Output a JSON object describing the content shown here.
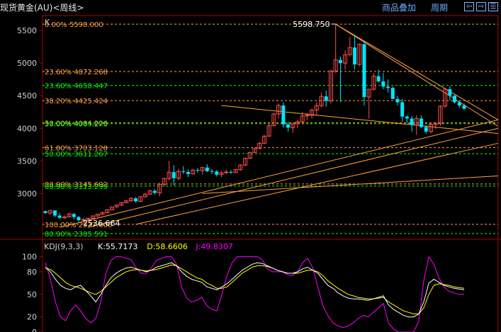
{
  "header": {
    "title": "现货黄金(AU)<周线>",
    "overlay_btn": "商品叠加",
    "period_btn": "周期",
    "prev_icon": "⇦",
    "next_icon": "⇨",
    "menu_icon": "☰"
  },
  "colors": {
    "up": "#ff4d4d",
    "down": "#00e5ff",
    "fib": "#ffa040",
    "fib_green": "#00ff00",
    "trend": "#ffa040",
    "k": "#ffffff",
    "d": "#ffff00",
    "j": "#ff00ff",
    "axis_text": "#d0d0d0",
    "frame": "#b00000",
    "grid": "#3a0000"
  },
  "chart_data": [
    {
      "type": "candlestick",
      "label": "K",
      "y_ticks": [
        3000,
        3500,
        4000,
        4500,
        5000,
        5500
      ],
      "ylim": [
        2330,
        5730
      ],
      "candles": [
        [
          2729,
          2736,
          2685,
          2700
        ],
        [
          2700,
          2745,
          2672,
          2740
        ],
        [
          2740,
          2745,
          2639,
          2661
        ],
        [
          2661,
          2703,
          2613,
          2627
        ],
        [
          2627,
          2665,
          2610,
          2640
        ],
        [
          2640,
          2706,
          2630,
          2685
        ],
        [
          2685,
          2700,
          2606,
          2639
        ],
        [
          2639,
          2655,
          2567,
          2590
        ],
        [
          2588,
          2626,
          2570,
          2603
        ],
        [
          2603,
          2630,
          2590,
          2620
        ],
        [
          2620,
          2665,
          2615,
          2655
        ],
        [
          2655,
          2690,
          2640,
          2684
        ],
        [
          2684,
          2720,
          2670,
          2705
        ],
        [
          2705,
          2760,
          2695,
          2750
        ],
        [
          2750,
          2800,
          2740,
          2795
        ],
        [
          2795,
          2836,
          2780,
          2822
        ],
        [
          2822,
          2870,
          2810,
          2860
        ],
        [
          2860,
          2899,
          2845,
          2888
        ],
        [
          2888,
          2945,
          2874,
          2925
        ],
        [
          2925,
          2948,
          2860,
          2880
        ],
        [
          2880,
          2956,
          2870,
          2950
        ],
        [
          2950,
          3010,
          2940,
          2990
        ],
        [
          2990,
          3057,
          2980,
          3040
        ],
        [
          3040,
          3070,
          2980,
          3009
        ],
        [
          3009,
          3167,
          2956,
          3140
        ],
        [
          3140,
          3245,
          3110,
          3230
        ],
        [
          3230,
          3500,
          3200,
          3327
        ],
        [
          3327,
          3435,
          3120,
          3235
        ],
        [
          3235,
          3380,
          3200,
          3340
        ],
        [
          3340,
          3420,
          3300,
          3330
        ],
        [
          3330,
          3369,
          3250,
          3300
        ],
        [
          3300,
          3380,
          3290,
          3360
        ],
        [
          3360,
          3390,
          3320,
          3350
        ],
        [
          3350,
          3410,
          3290,
          3398
        ],
        [
          3398,
          3450,
          3330,
          3342
        ],
        [
          3342,
          3375,
          3300,
          3337
        ],
        [
          3337,
          3360,
          3260,
          3290
        ],
        [
          3290,
          3340,
          3250,
          3318
        ],
        [
          3318,
          3370,
          3300,
          3330
        ],
        [
          3330,
          3360,
          3300,
          3320
        ],
        [
          3320,
          3380,
          3320,
          3365
        ],
        [
          3365,
          3450,
          3350,
          3435
        ],
        [
          3435,
          3550,
          3420,
          3540
        ],
        [
          3540,
          3640,
          3530,
          3630
        ],
        [
          3630,
          3700,
          3620,
          3690
        ],
        [
          3690,
          3790,
          3680,
          3770
        ],
        [
          3770,
          3900,
          3760,
          3880
        ],
        [
          3880,
          4060,
          3870,
          4040
        ],
        [
          4040,
          4240,
          4030,
          4220
        ],
        [
          4220,
          4380,
          4150,
          4350
        ],
        [
          4350,
          4400,
          4010,
          4060
        ],
        [
          4060,
          4100,
          3950,
          4010
        ],
        [
          4010,
          4080,
          3930,
          4070
        ],
        [
          4070,
          4130,
          4000,
          4100
        ],
        [
          4100,
          4250,
          4060,
          4190
        ],
        [
          4190,
          4240,
          4130,
          4200
        ],
        [
          4200,
          4300,
          4150,
          4280
        ],
        [
          4280,
          4400,
          4200,
          4350
        ],
        [
          4350,
          4550,
          4320,
          4490
        ],
        [
          4490,
          4580,
          4330,
          4420
        ],
        [
          4420,
          4900,
          4380,
          4880
        ],
        [
          4880,
          5600,
          4850,
          5050
        ],
        [
          5050,
          5100,
          4400,
          5000
        ],
        [
          5000,
          5200,
          4900,
          5130
        ],
        [
          5130,
          5400,
          5100,
          5240
        ],
        [
          5240,
          5420,
          4900,
          4980
        ],
        [
          4980,
          5300,
          4950,
          5290
        ],
        [
          5290,
          5340,
          4350,
          4480
        ],
        [
          4480,
          4600,
          4150,
          4600
        ],
        [
          4600,
          4850,
          4580,
          4800
        ],
        [
          4800,
          4900,
          4700,
          4720
        ],
        [
          4720,
          4850,
          4600,
          4640
        ],
        [
          4640,
          4750,
          4550,
          4620
        ],
        [
          4620,
          4640,
          4450,
          4450
        ],
        [
          4450,
          4500,
          4350,
          4400
        ],
        [
          4400,
          4450,
          4100,
          4180
        ],
        [
          4180,
          4200,
          4080,
          4150
        ],
        [
          4150,
          4190,
          3950,
          4050
        ],
        [
          4050,
          4200,
          3900,
          4150
        ],
        [
          4150,
          4200,
          4000,
          4020
        ],
        [
          4020,
          4050,
          3920,
          3950
        ],
        [
          3950,
          4080,
          3920,
          4060
        ],
        [
          4060,
          4100,
          3990,
          4070
        ],
        [
          4070,
          4350,
          4040,
          4340
        ],
        [
          4340,
          4620,
          4320,
          4600
        ],
        [
          4600,
          4650,
          4430,
          4500
        ],
        [
          4500,
          4530,
          4380,
          4400
        ],
        [
          4400,
          4420,
          4310,
          4350
        ],
        [
          4350,
          4380,
          4280,
          4300
        ]
      ],
      "fib_levels": [
        {
          "label": "0.00% 5598.000",
          "y": 5598,
          "color_key": "fib"
        },
        {
          "label": "23.60% 4872.268",
          "y": 4872,
          "color_key": "fib"
        },
        {
          "label": "23.60% 4658.447",
          "y": 4658,
          "color_key": "fib_green"
        },
        {
          "label": "38.20% 4425.424",
          "y": 4425,
          "color_key": "fib"
        },
        {
          "label": "50.00% 4084.226",
          "y": 4086,
          "color_key": "fib"
        },
        {
          "label": "50.00% 4069.275",
          "y": 4071,
          "color_key": "fib_green"
        },
        {
          "label": "61.80% 3703.128",
          "y": 3703,
          "color_key": "fib"
        },
        {
          "label": "50.00% 3611.267",
          "y": 3611,
          "color_key": "fib_green"
        },
        {
          "label": "80.90% 3145.692",
          "y": 3146,
          "color_key": "fib"
        },
        {
          "label": "80.90% 3113.299",
          "y": 3113,
          "color_key": "fib_green"
        },
        {
          "label": "100.00% 2527.000",
          "y": 2527,
          "color_key": "fib"
        },
        {
          "label": "80.90% 2385.591",
          "y": 2386,
          "color_key": "fib_green"
        }
      ],
      "annotations": {
        "high": "5598.750",
        "low": "2536.664"
      },
      "trendlines": [
        [
          [
            61,
            5598
          ],
          [
            100,
            4130
          ]
        ],
        [
          [
            61,
            5598
          ],
          [
            100,
            4030
          ]
        ],
        [
          [
            37,
            4350
          ],
          [
            100,
            3920
          ]
        ],
        [
          [
            3,
            2480
          ],
          [
            100,
            4130
          ]
        ],
        [
          [
            9,
            2480
          ],
          [
            100,
            4000
          ]
        ],
        [
          [
            19,
            2527
          ],
          [
            100,
            3770
          ]
        ],
        [
          [
            33,
            3000
          ],
          [
            100,
            3270
          ]
        ]
      ]
    },
    {
      "type": "line",
      "label": "KDJ(9,3,3)",
      "legend": [
        {
          "name": "K:55.7173",
          "color_key": "k"
        },
        {
          "name": "D:58.6606",
          "color_key": "d"
        },
        {
          "name": "J:49.8307",
          "color_key": "j"
        }
      ],
      "y_ticks": [
        0,
        20,
        50,
        80,
        100
      ],
      "ylim": [
        0,
        110
      ],
      "series": {
        "K": [
          86,
          80,
          70,
          62,
          58,
          56,
          60,
          62,
          55,
          48,
          40,
          50,
          62,
          72,
          78,
          82,
          85,
          86,
          84,
          82,
          80,
          82,
          86,
          88,
          90,
          92,
          88,
          80,
          74,
          70,
          68,
          66,
          60,
          58,
          56,
          60,
          64,
          70,
          76,
          82,
          86,
          90,
          92,
          91,
          88,
          85,
          82,
          80,
          78,
          78,
          80,
          84,
          86,
          82,
          78,
          70,
          62,
          58,
          52,
          48,
          45,
          44,
          44,
          43,
          42,
          44,
          46,
          48,
          36,
          30,
          26,
          22,
          20,
          20,
          24,
          40,
          65,
          70,
          66,
          62,
          60,
          58,
          57,
          56
        ],
        "D": [
          85,
          83,
          78,
          72,
          66,
          62,
          60,
          58,
          55,
          52,
          50,
          54,
          60,
          66,
          72,
          76,
          80,
          82,
          83,
          82,
          81,
          82,
          83,
          85,
          87,
          89,
          88,
          84,
          80,
          76,
          72,
          70,
          65,
          62,
          58,
          58,
          60,
          66,
          72,
          78,
          82,
          86,
          88,
          88,
          87,
          85,
          82,
          80,
          78,
          78,
          78,
          80,
          82,
          82,
          80,
          75,
          68,
          63,
          58,
          54,
          50,
          48,
          46,
          45,
          44,
          44,
          45,
          46,
          40,
          36,
          32,
          28,
          26,
          24,
          24,
          32,
          50,
          62,
          64,
          63,
          62,
          60,
          59,
          58
        ],
        "J": [
          92,
          70,
          40,
          20,
          15,
          28,
          36,
          28,
          18,
          12,
          18,
          40,
          78,
          95,
          100,
          100,
          98,
          96,
          85,
          78,
          78,
          85,
          95,
          98,
          100,
          100,
          90,
          60,
          45,
          40,
          42,
          46,
          35,
          30,
          28,
          50,
          75,
          92,
          100,
          100,
          100,
          100,
          100,
          96,
          84,
          80,
          80,
          80,
          76,
          75,
          80,
          92,
          98,
          85,
          60,
          35,
          22,
          12,
          8,
          6,
          8,
          12,
          18,
          22,
          20,
          26,
          32,
          38,
          12,
          4,
          0,
          0,
          0,
          0,
          14,
          68,
          100,
          90,
          72,
          60,
          54,
          52,
          50,
          50
        ]
      }
    }
  ]
}
